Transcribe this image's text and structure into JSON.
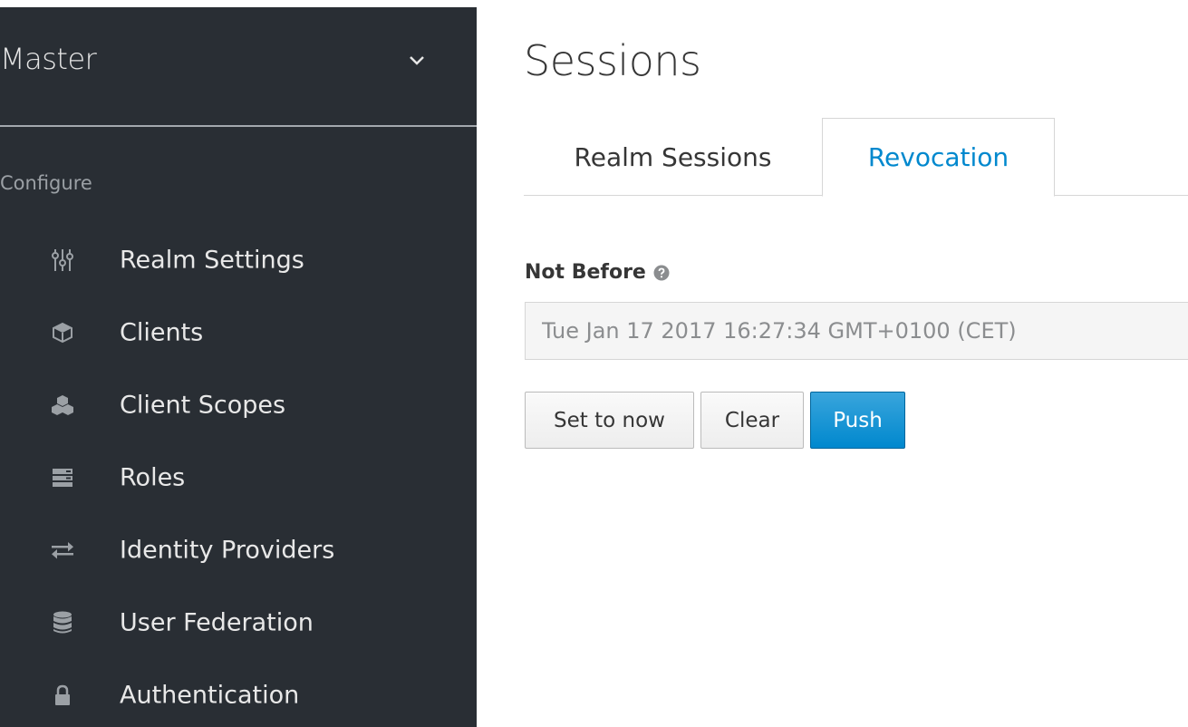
{
  "sidebar": {
    "realm": "Master",
    "section": "Configure",
    "items": [
      {
        "label": "Realm Settings",
        "icon": "sliders-icon"
      },
      {
        "label": "Clients",
        "icon": "cube-icon"
      },
      {
        "label": "Client Scopes",
        "icon": "cubes-icon"
      },
      {
        "label": "Roles",
        "icon": "server-stack-icon"
      },
      {
        "label": "Identity Providers",
        "icon": "exchange-arrows-icon"
      },
      {
        "label": "User Federation",
        "icon": "database-icon"
      },
      {
        "label": "Authentication",
        "icon": "lock-icon"
      }
    ]
  },
  "main": {
    "title": "Sessions",
    "tabs": [
      {
        "label": "Realm Sessions",
        "active": false
      },
      {
        "label": "Revocation",
        "active": true
      }
    ],
    "not_before": {
      "label": "Not Before",
      "value": "Tue Jan 17 2017 16:27:34 GMT+0100 (CET)"
    },
    "buttons": {
      "set_now": "Set to now",
      "clear": "Clear",
      "push": "Push"
    }
  },
  "colors": {
    "sidebar_bg": "#292e34",
    "accent": "#0088ce",
    "push_button": "#0088ce"
  }
}
